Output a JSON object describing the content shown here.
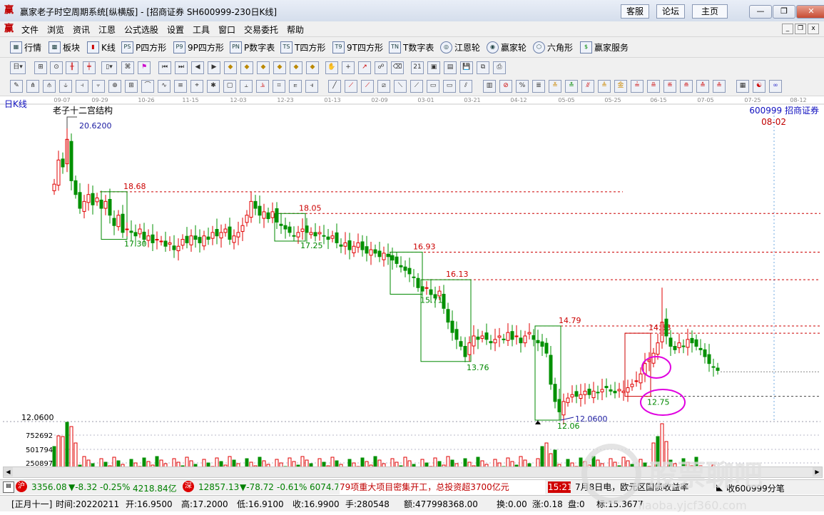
{
  "window": {
    "title": "赢家老子时空周期系统[纵横版] - [招商证券  SH600999-230日K线]",
    "links": [
      "客服",
      "论坛",
      "主页"
    ],
    "controls": [
      "minimize",
      "restore",
      "close"
    ]
  },
  "menu": [
    "文件",
    "浏览",
    "资讯",
    "江恩",
    "公式选股",
    "设置",
    "工具",
    "窗口",
    "交易委托",
    "帮助"
  ],
  "toolbar1": [
    {
      "label": "行情",
      "icon": "grid-icon"
    },
    {
      "label": "板块",
      "icon": "blocks-icon"
    },
    {
      "label": "K线",
      "icon": "candle-icon"
    },
    {
      "label": "P四方形",
      "icon": "ps-icon"
    },
    {
      "label": "9P四方形",
      "icon": "p9-icon"
    },
    {
      "label": "P数字表",
      "icon": "pn-icon"
    },
    {
      "label": "T四方形",
      "icon": "ts-icon"
    },
    {
      "label": "9T四方形",
      "icon": "t9-icon"
    },
    {
      "label": "T数字表",
      "icon": "tn-icon"
    },
    {
      "label": "江恩轮",
      "icon": "gann-wheel-icon"
    },
    {
      "label": "赢家轮",
      "icon": "winner-wheel-icon"
    },
    {
      "label": "六角形",
      "icon": "hexagon-icon"
    },
    {
      "label": "赢家服务",
      "icon": "dollar-icon"
    }
  ],
  "chart": {
    "period_label": "日K线",
    "structure_label": "老子十二宫结构",
    "symbol_label": "600999  招商证券",
    "right_date": "08-02",
    "dates": [
      "09-07",
      "09-29",
      "10-26",
      "11-15",
      "12-03",
      "12-23",
      "01-13",
      "02-09",
      "03-01",
      "03-21",
      "04-12",
      "05-05",
      "05-25",
      "06-15",
      "07-05",
      "07-25",
      "08-12"
    ],
    "price_high": "20.6200",
    "price_low_left": "12.0600",
    "price_low_mark": "12.0600",
    "levels": [
      {
        "label": "18.68",
        "value": 18.68
      },
      {
        "label": "18.05",
        "value": 18.05
      },
      {
        "label": "16.93",
        "value": 16.93
      },
      {
        "label": "16.13",
        "value": 16.13
      },
      {
        "label": "14.79",
        "value": 14.79
      },
      {
        "label": "14.58",
        "value": 14.58
      }
    ],
    "lows": [
      {
        "label": "17.30",
        "value": 17.3
      },
      {
        "label": "17.25",
        "value": 17.25
      },
      {
        "label": "15.71",
        "value": 15.71
      },
      {
        "label": "13.76",
        "value": 13.76
      },
      {
        "label": "12.06",
        "value": 12.06
      },
      {
        "label": "12.75",
        "value": 12.75
      }
    ],
    "volume_ticks": [
      "752692",
      "501794",
      "250897"
    ],
    "colors": {
      "up": "#e00000",
      "down": "#009000",
      "level": "#cc0000",
      "box": "#008800",
      "highlight": "#e000e0"
    }
  },
  "status": {
    "sh_index": "3356.08",
    "sh_change": "▼-8.32",
    "sh_pct": "-0.25%",
    "sh_amount": "4218.84亿",
    "sz_index": "12857.13",
    "sz_change": "▼-78.72",
    "sz_pct": "-0.61%",
    "sz_amount": "6074.79",
    "ticker": "79项重大项目密集开工，总投资超3700亿元",
    "clock": "15:21",
    "news2": "7月8日电，欧元区国债收益率",
    "watch": "收600999分笔"
  },
  "info": {
    "lunar": "[正月十一]",
    "time": "时间:20220211",
    "open": "开:16.9500",
    "high": "高:17.2000",
    "low": "低:16.9100",
    "close": "收:16.9900",
    "hands": "手:280548",
    "amount": "额:477998368.00",
    "turnover": "换:0.00",
    "change": "涨:0.18",
    "pan": "盘:0",
    "mark": "标:15.3677"
  },
  "watermark": "liaoba.yjcf360.com"
}
